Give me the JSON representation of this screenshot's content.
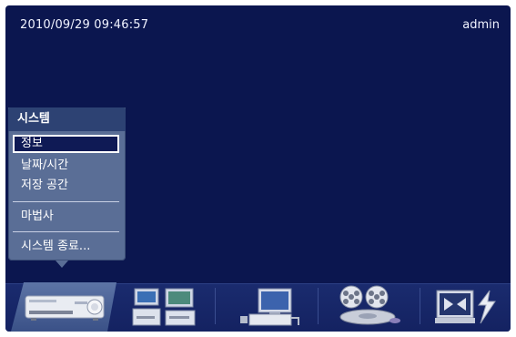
{
  "status": {
    "datetime": "2010/09/29  09:46:57",
    "user": "admin"
  },
  "menu": {
    "title": "시스템",
    "items": [
      {
        "label": "정보",
        "selected": true
      },
      {
        "label": "날짜/시간"
      },
      {
        "label": "저장 공간"
      },
      {
        "label": "마법사"
      },
      {
        "label": "시스템 종료..."
      }
    ]
  },
  "dock": {
    "items": [
      {
        "icon": "dvr-system-icon",
        "active": true
      },
      {
        "icon": "network-computers-icon"
      },
      {
        "icon": "monitor-device-icon"
      },
      {
        "icon": "film-reels-record-icon"
      },
      {
        "icon": "event-alarm-icon"
      }
    ]
  },
  "colors": {
    "background": "#0b164f",
    "menu": "#5a6e96",
    "menu_header": "#2d4273",
    "selected": "#0f1a55"
  }
}
